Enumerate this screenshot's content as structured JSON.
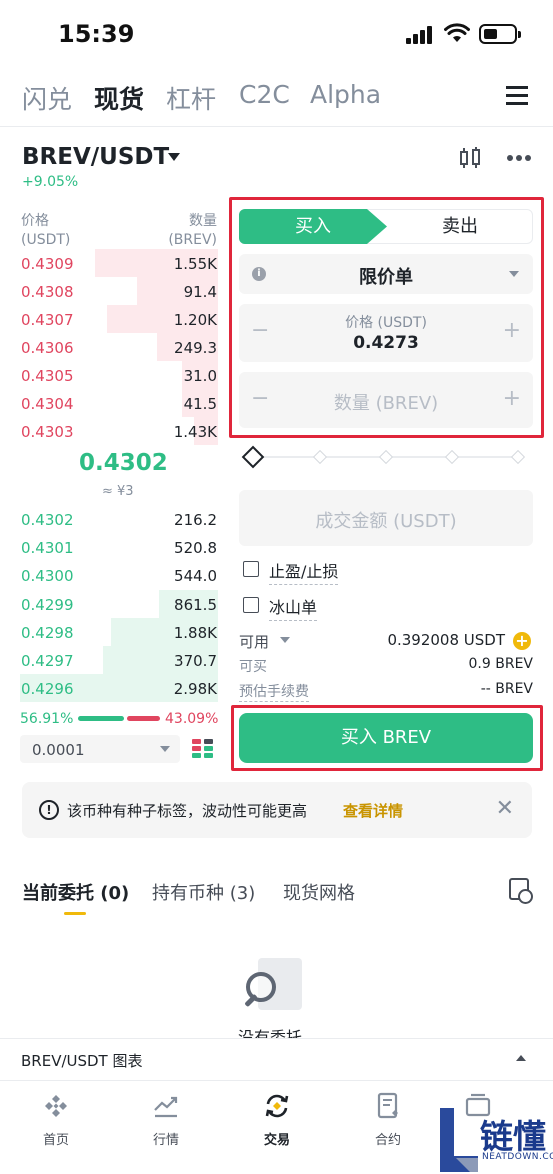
{
  "status_bar": {
    "time": "15:39"
  },
  "top_tabs": [
    {
      "label": "闪兑",
      "active": false
    },
    {
      "label": "现货",
      "active": true
    },
    {
      "label": "杠杆",
      "active": false
    },
    {
      "label": "C2C",
      "active": false
    },
    {
      "label": "Alpha",
      "active": false
    }
  ],
  "pair": {
    "name": "BREV/USDT",
    "change": "+9.05%"
  },
  "orderbook": {
    "price_header": "价格",
    "price_unit": "(USDT)",
    "qty_header": "数量",
    "qty_unit": "(BREV)",
    "asks": [
      {
        "price": "0.4309",
        "qty": "1.55K",
        "depth": 0.62
      },
      {
        "price": "0.4308",
        "qty": "91.4",
        "depth": 0.41
      },
      {
        "price": "0.4307",
        "qty": "1.20K",
        "depth": 0.56
      },
      {
        "price": "0.4306",
        "qty": "249.3",
        "depth": 0.31
      },
      {
        "price": "0.4305",
        "qty": "31.0",
        "depth": 0.18
      },
      {
        "price": "0.4304",
        "qty": "41.5",
        "depth": 0.18
      },
      {
        "price": "0.4303",
        "qty": "1.43K",
        "depth": 0.12
      }
    ],
    "mid_price": "0.4302",
    "mid_cny": "≈ ¥3",
    "bids": [
      {
        "price": "0.4302",
        "qty": "216.2",
        "depth": 0.0
      },
      {
        "price": "0.4301",
        "qty": "520.8",
        "depth": 0.0
      },
      {
        "price": "0.4300",
        "qty": "544.0",
        "depth": 0.0
      },
      {
        "price": "0.4299",
        "qty": "861.5",
        "depth": 0.3
      },
      {
        "price": "0.4298",
        "qty": "1.88K",
        "depth": 0.54
      },
      {
        "price": "0.4297",
        "qty": "370.7",
        "depth": 0.58
      },
      {
        "price": "0.4296",
        "qty": "2.98K",
        "depth": 1.0
      }
    ],
    "buy_ratio": "56.91%",
    "sell_ratio": "43.09%",
    "depth_step": "0.0001"
  },
  "order_form": {
    "buy_label": "买入",
    "sell_label": "卖出",
    "order_type": "限价单",
    "price_label": "价格 (USDT)",
    "price_value": "0.4273",
    "qty_placeholder": "数量 (BREV)",
    "amount_placeholder": "成交金额 (USDT)",
    "tp_sl_label": "止盈/止损",
    "iceberg_label": "冰山单",
    "available_label": "可用",
    "available_value": "0.392008 USDT",
    "can_buy_label": "可买",
    "can_buy_value": "0.9 BREV",
    "fee_label": "预估手续费",
    "fee_value": "-- BREV",
    "submit_label": "买入 BREV"
  },
  "notice": {
    "text": "该币种有种子标签，波动性可能更高",
    "link": "查看详情"
  },
  "bottom_tabs": [
    {
      "label": "当前委托 (0)",
      "active": true
    },
    {
      "label": "持有币种 (3)",
      "active": false
    },
    {
      "label": "现货网格",
      "active": false
    }
  ],
  "empty_text": "没有委托",
  "chart_bar_label": "BREV/USDT 图表",
  "nav": [
    {
      "label": "首页",
      "icon": "home-icon"
    },
    {
      "label": "行情",
      "icon": "markets-icon"
    },
    {
      "label": "交易",
      "icon": "trade-icon"
    },
    {
      "label": "合约",
      "icon": "futures-icon"
    },
    {
      "label": "资产",
      "icon": "wallet-icon"
    }
  ],
  "watermark": {
    "brand": "链懂",
    "site": "NEATDOWN.COM"
  },
  "colors": {
    "green": "#2ebd85",
    "red": "#e0455f",
    "gold": "#f0b90b",
    "highlight": "#e0263b"
  }
}
